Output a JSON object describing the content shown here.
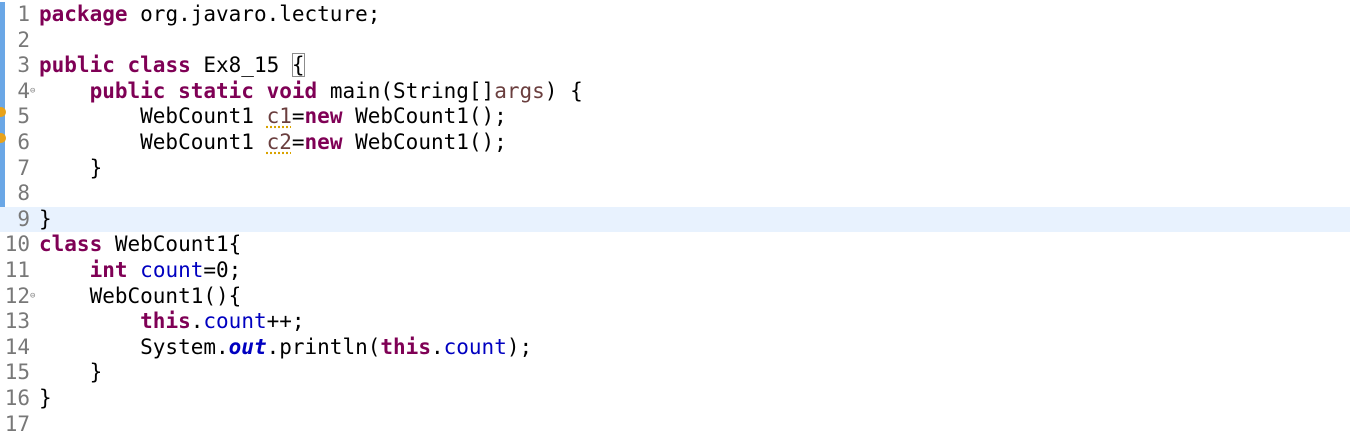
{
  "editor": {
    "current_line": 9,
    "change_bar_lines": [
      1,
      9
    ],
    "warning_lines": [
      5,
      6
    ],
    "lines": [
      {
        "n": "1",
        "fold": false,
        "tokens": [
          {
            "t": "package",
            "c": "kw"
          },
          {
            "t": " org.javaro.lecture;"
          }
        ]
      },
      {
        "n": "2",
        "fold": false,
        "tokens": []
      },
      {
        "n": "3",
        "fold": false,
        "tokens": [
          {
            "t": "public",
            "c": "kw"
          },
          {
            "t": " "
          },
          {
            "t": "class",
            "c": "kw"
          },
          {
            "t": " Ex8_15 "
          },
          {
            "t": "{",
            "c": "bracket"
          }
        ]
      },
      {
        "n": "4",
        "fold": true,
        "tokens": [
          {
            "t": "    "
          },
          {
            "t": "public",
            "c": "kw"
          },
          {
            "t": " "
          },
          {
            "t": "static",
            "c": "kw"
          },
          {
            "t": " "
          },
          {
            "t": "void",
            "c": "kw"
          },
          {
            "t": " main(String[]"
          },
          {
            "t": "args",
            "c": "par"
          },
          {
            "t": ") {"
          }
        ]
      },
      {
        "n": "5",
        "fold": false,
        "tokens": [
          {
            "t": "        WebCount1 "
          },
          {
            "t": "c1",
            "c": "lv"
          },
          {
            "t": "="
          },
          {
            "t": "new",
            "c": "kw"
          },
          {
            "t": " WebCount1();"
          }
        ]
      },
      {
        "n": "6",
        "fold": false,
        "tokens": [
          {
            "t": "        WebCount1 "
          },
          {
            "t": "c2",
            "c": "lv"
          },
          {
            "t": "="
          },
          {
            "t": "new",
            "c": "kw"
          },
          {
            "t": " WebCount1();"
          }
        ]
      },
      {
        "n": "7",
        "fold": false,
        "tokens": [
          {
            "t": "    }"
          }
        ]
      },
      {
        "n": "8",
        "fold": false,
        "tokens": []
      },
      {
        "n": "9",
        "fold": false,
        "tokens": [
          {
            "t": "}"
          }
        ]
      },
      {
        "n": "10",
        "fold": false,
        "tokens": [
          {
            "t": "class",
            "c": "kw"
          },
          {
            "t": " WebCount1{"
          }
        ]
      },
      {
        "n": "11",
        "fold": false,
        "tokens": [
          {
            "t": "    "
          },
          {
            "t": "int",
            "c": "kw"
          },
          {
            "t": " "
          },
          {
            "t": "count",
            "c": "fld"
          },
          {
            "t": "=0;"
          }
        ]
      },
      {
        "n": "12",
        "fold": true,
        "tokens": [
          {
            "t": "    WebCount1(){"
          }
        ]
      },
      {
        "n": "13",
        "fold": false,
        "tokens": [
          {
            "t": "        "
          },
          {
            "t": "this",
            "c": "kw"
          },
          {
            "t": "."
          },
          {
            "t": "count",
            "c": "fld"
          },
          {
            "t": "++;"
          }
        ]
      },
      {
        "n": "14",
        "fold": false,
        "tokens": [
          {
            "t": "        System."
          },
          {
            "t": "out",
            "c": "sfld"
          },
          {
            "t": ".println("
          },
          {
            "t": "this",
            "c": "kw"
          },
          {
            "t": "."
          },
          {
            "t": "count",
            "c": "fld"
          },
          {
            "t": ");"
          }
        ]
      },
      {
        "n": "15",
        "fold": false,
        "tokens": [
          {
            "t": "    }"
          }
        ]
      },
      {
        "n": "16",
        "fold": false,
        "tokens": [
          {
            "t": "}"
          }
        ]
      },
      {
        "n": "17",
        "fold": false,
        "tokens": []
      }
    ]
  }
}
